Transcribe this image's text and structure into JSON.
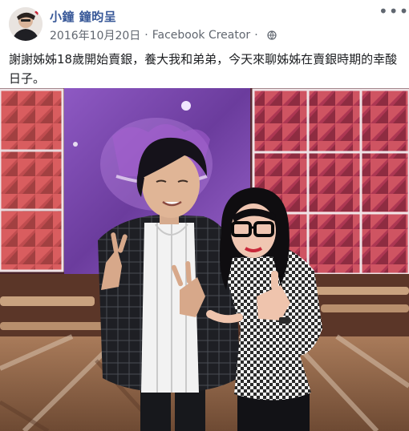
{
  "post": {
    "author_name": "小鐘  鐘昀呈",
    "date": "2016年10月20日",
    "separator": "·",
    "app": "Facebook Creator",
    "privacy_icon": "globe-icon",
    "more_icon": "more-options-icon",
    "more_glyph": "•••",
    "caption": "謝謝姊姊18歲開始賣銀，養大我和弟弟，今天來聊姊姊在賣銀時期的幸酸日子。"
  },
  "colors": {
    "author_link": "#385898",
    "meta_text": "#616770",
    "body_text": "#1c1e21",
    "studio_panel_red": "#b8324a",
    "studio_screen_purple": "#7b4aa8",
    "studio_floor": "#8a5a3c"
  }
}
